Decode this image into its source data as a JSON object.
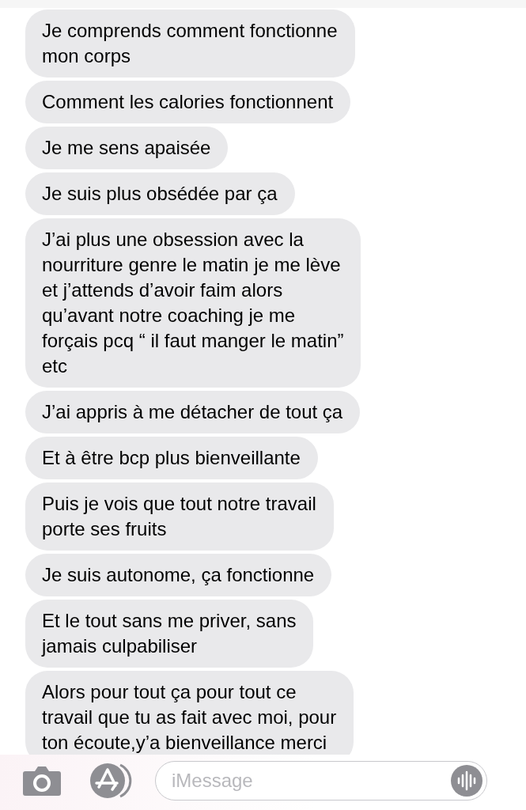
{
  "messages": [
    {
      "text": "Je comprends comment fonctionne\nmon corps"
    },
    {
      "text": "Comment les calories fonctionnent"
    },
    {
      "text": "Je me sens apaisée"
    },
    {
      "text": "Je suis plus obsédée par ça"
    },
    {
      "text": "J’ai plus une obsession avec la\nnourriture genre le matin je me lève\net j’attends d’avoir faim alors\nqu’avant notre coaching je me\nforçais pcq “ il faut manger le matin”\netc"
    },
    {
      "text": "J’ai appris à me détacher de tout ça"
    },
    {
      "text": "Et à être bcp plus bienveillante"
    },
    {
      "text": "Puis je vois que tout notre travail\nporte ses fruits"
    },
    {
      "text": "Je suis autonome, ça fonctionne"
    },
    {
      "text": "Et le tout sans me priver, sans\njamais culpabiliser"
    },
    {
      "text": "Alors pour tout ça pour tout ce\ntravail que tu as fait avec moi, pour\nton écoute,y’a bienveillance merci"
    }
  ],
  "composer": {
    "placeholder": "iMessage"
  }
}
